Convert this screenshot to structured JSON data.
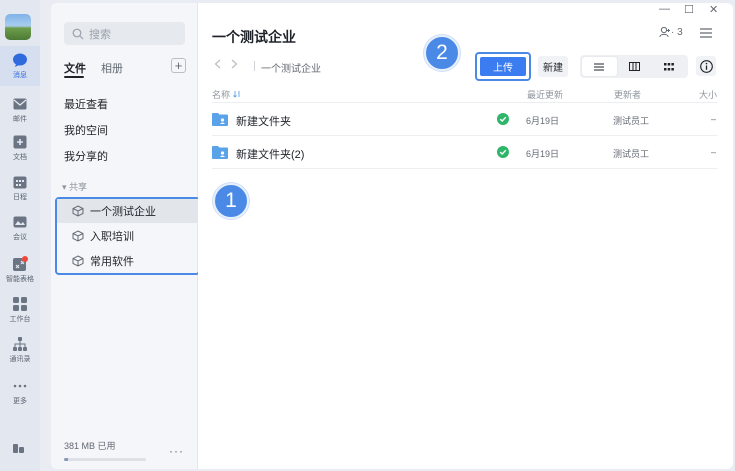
{
  "rail": {
    "items": [
      {
        "label": "消息",
        "icon": "chat-icon"
      },
      {
        "label": "邮件",
        "icon": "mail-icon"
      },
      {
        "label": "文档",
        "icon": "doc-icon"
      },
      {
        "label": "日程",
        "icon": "calendar-icon"
      },
      {
        "label": "会议",
        "icon": "meeting-icon"
      },
      {
        "label": "智能表格",
        "icon": "smart-table-icon"
      },
      {
        "label": "工作台",
        "icon": "workbench-icon"
      },
      {
        "label": "通讯录",
        "icon": "contacts-icon"
      },
      {
        "label": "更多",
        "icon": "more-icon"
      }
    ]
  },
  "sidebar": {
    "search_placeholder": "搜索",
    "tabs": {
      "files": "文件",
      "album": "相册"
    },
    "add_label": "+",
    "nav": [
      "最近查看",
      "我的空间",
      "我分享的"
    ],
    "section_label": "▾ 共享",
    "enterprises": [
      "一个测试企业",
      "入职培训",
      "常用软件"
    ],
    "storage_label": "381 MB 已用",
    "storage_used_fraction": 0.05,
    "more_label": "···"
  },
  "main": {
    "title": "一个测试企业",
    "window": {
      "minimize": "—",
      "maximize": "☐",
      "close": "✕"
    },
    "members_count": "· 3",
    "breadcrumb": "一个测试企业",
    "upload_label": "上传",
    "new_label": "新建",
    "columns": {
      "name": "名称",
      "updated": "最近更新",
      "updater": "更新者",
      "size": "大小"
    },
    "files": [
      {
        "name": "新建文件夹",
        "date": "6月19日",
        "owner": "测试员工",
        "size": "–"
      },
      {
        "name": "新建文件夹(2)",
        "date": "6月19日",
        "owner": "测试员工",
        "size": "–"
      }
    ]
  },
  "markers": {
    "one": "1",
    "two": "2"
  },
  "colors": {
    "accent": "#3b7cf0",
    "highlight": "#4a8ae6",
    "sync_ok": "#2fb56a",
    "folder": "#5aa3e8"
  }
}
